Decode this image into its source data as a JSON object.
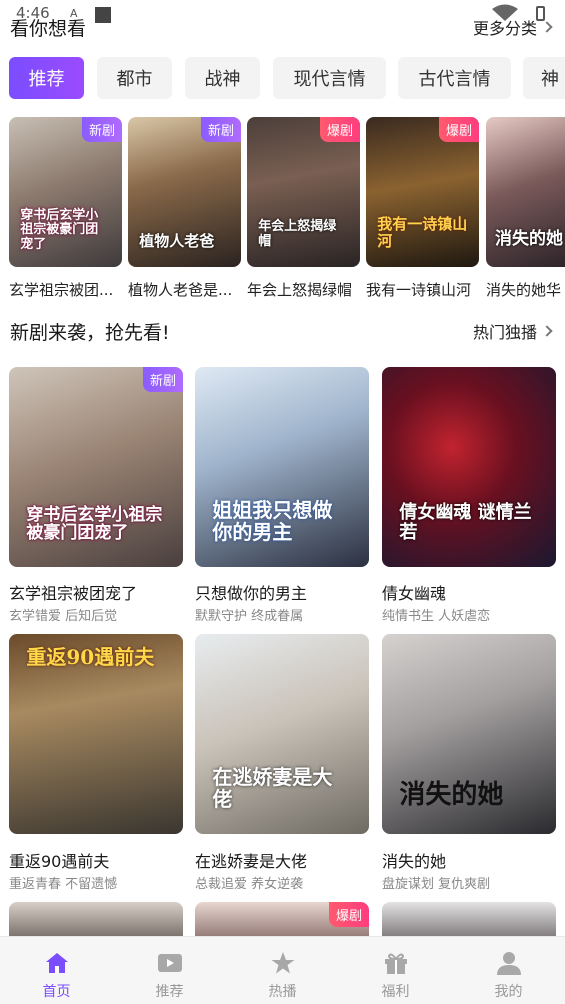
{
  "status_bar": {
    "time": "4:46"
  },
  "section_guess": {
    "title": "看你想看",
    "more": "更多分类"
  },
  "categories": [
    {
      "label": "推荐",
      "active": true
    },
    {
      "label": "都市"
    },
    {
      "label": "战神"
    },
    {
      "label": "现代言情"
    },
    {
      "label": "古代言情"
    },
    {
      "label": "神"
    }
  ],
  "row1": [
    {
      "title": "玄学祖宗被团...",
      "tag": "新剧",
      "poster_text": "穿书后玄学小祖宗被豪门团宠了"
    },
    {
      "title": "植物人老爸是...",
      "tag": "新剧",
      "poster_text": "植物人老爸"
    },
    {
      "title": "年会上怒揭绿帽",
      "tag": "爆剧",
      "poster_text": "年会上怒揭绿帽"
    },
    {
      "title": "我有一诗镇山河",
      "tag": "爆剧",
      "poster_text": "我有一诗镇山河"
    },
    {
      "title": "消失的她华",
      "tag": "",
      "poster_text": "消失的她"
    }
  ],
  "section_new": {
    "title": "新剧来袭，抢先看!",
    "more": "热门独播"
  },
  "grid": [
    {
      "title": "玄学祖宗被团宠了",
      "sub": "玄学错爱 后知后觉",
      "tag": "新剧",
      "poster_text": "穿书后玄学小祖宗被豪门团宠了"
    },
    {
      "title": "只想做你的男主",
      "sub": "默默守护 终成眷属",
      "tag": "",
      "poster_text": "姐姐我只想做你的男主"
    },
    {
      "title": "倩女幽魂",
      "sub": "纯情书生 人妖虐恋",
      "tag": "",
      "poster_text": "倩女幽魂 谜情兰若"
    },
    {
      "title": "重返90遇前夫",
      "sub": "重返青春 不留遗憾",
      "tag": "",
      "poster_text": "重返90遇前夫"
    },
    {
      "title": "在逃娇妻是大佬",
      "sub": "总裁追爱 养女逆袭",
      "tag": "",
      "poster_text": "在逃娇妻是大佬"
    },
    {
      "title": "消失的她",
      "sub": "盘旋谋划 复仇爽剧",
      "tag": "",
      "poster_text": "消失的她"
    },
    {
      "title": "",
      "sub": "",
      "tag": "",
      "poster_text": ""
    },
    {
      "title": "",
      "sub": "",
      "tag": "爆剧",
      "poster_text": ""
    },
    {
      "title": "",
      "sub": "",
      "tag": "",
      "poster_text": ""
    }
  ],
  "bottom_nav": [
    {
      "label": "首页",
      "icon": "home-icon",
      "active": true
    },
    {
      "label": "推荐",
      "icon": "play-icon"
    },
    {
      "label": "热播",
      "icon": "star-icon"
    },
    {
      "label": "福利",
      "icon": "gift-icon"
    },
    {
      "label": "我的",
      "icon": "user-icon"
    }
  ],
  "colors": {
    "accent": "#7b4dff",
    "tag_new": "#9b5cff",
    "tag_hot": "#ff4a75"
  }
}
